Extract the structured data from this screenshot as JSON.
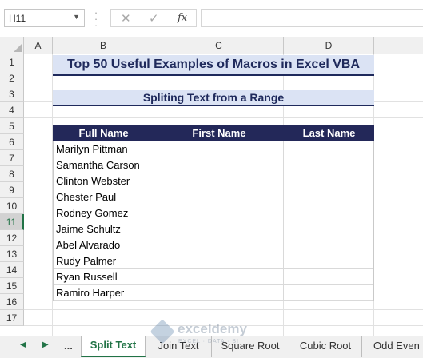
{
  "formula_bar": {
    "name_box": "H11",
    "cancel_glyph": "✕",
    "enter_glyph": "✓",
    "fx_label": "fx",
    "formula": ""
  },
  "columns": [
    "A",
    "B",
    "C",
    "D"
  ],
  "rows": [
    "1",
    "2",
    "3",
    "4",
    "5",
    "6",
    "7",
    "8",
    "9",
    "10",
    "11",
    "12",
    "13",
    "14",
    "15",
    "16",
    "17"
  ],
  "selected_row": "11",
  "sheet": {
    "title": "Top 50 Useful Examples of Macros in Excel VBA",
    "subtitle": "Spliting Text from a Range",
    "headers": [
      "Full Name",
      "First Name",
      "Last Name"
    ],
    "names": [
      "Marilyn Pittman",
      "Samantha Carson",
      "Clinton Webster",
      "Chester Paul",
      "Rodney Gomez",
      "Jaime Schultz",
      "Abel Alvarado",
      "Rudy Palmer",
      "Ryan Russell",
      "Ramiro Harper"
    ]
  },
  "watermark": {
    "name": "exceldemy",
    "tagline": "EXCEL · DATA · BI"
  },
  "tabs": {
    "nav_prev": "◀",
    "nav_next": "▶",
    "more": "...",
    "items": [
      "Split Text",
      "Join Text",
      "Square Root",
      "Cubic Root",
      "Odd Even"
    ],
    "active": "Split Text"
  },
  "colors": {
    "accent": "#217346",
    "title_text": "#1f2a5c",
    "band": "#dbe3f4",
    "header_bg": "#232859"
  }
}
